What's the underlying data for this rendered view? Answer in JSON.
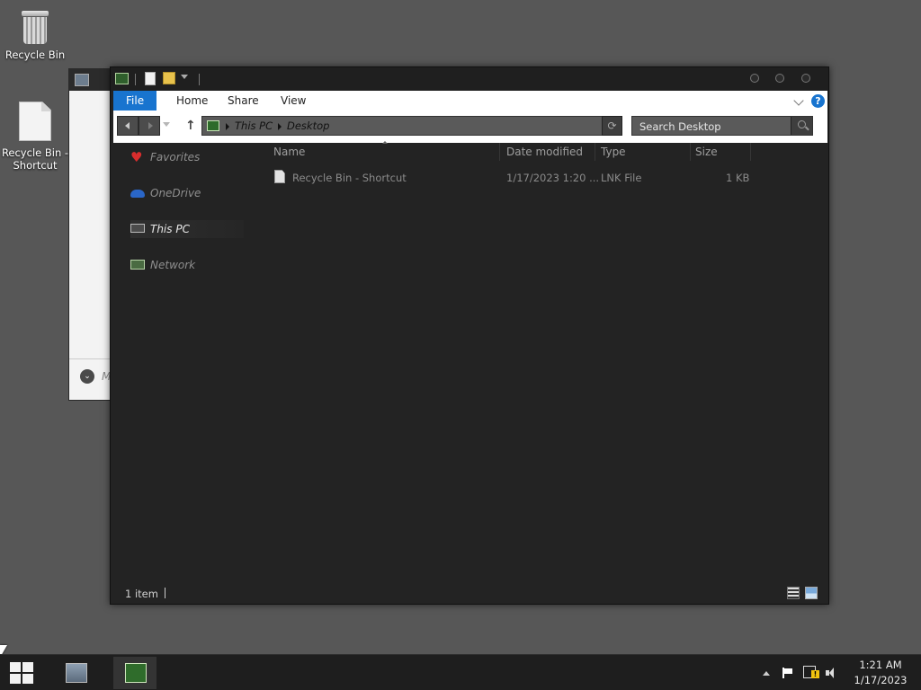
{
  "desktop": {
    "icons": [
      {
        "label": "Recycle Bin"
      },
      {
        "label": "Recycle Bin - Shortcut"
      }
    ]
  },
  "background_window": {
    "footer_text": "M"
  },
  "explorer": {
    "quick_access": [
      "explorer-icon",
      "properties-icon",
      "new-folder-icon",
      "customize-dropdown"
    ],
    "ribbon_tabs": [
      "File",
      "Home",
      "Share",
      "View"
    ],
    "help_label": "?",
    "address": {
      "crumbs": [
        "This PC",
        "Desktop"
      ]
    },
    "refresh_label": "⟳",
    "search": {
      "placeholder": "Search Desktop"
    },
    "nav_pane": [
      {
        "label": "Favorites",
        "icon": "heart-icon"
      },
      {
        "label": "OneDrive",
        "icon": "cloud-icon"
      },
      {
        "label": "This PC",
        "icon": "monitor-icon",
        "selected": true
      },
      {
        "label": "Network",
        "icon": "network-icon"
      }
    ],
    "columns": [
      "Name",
      "Date modified",
      "Type",
      "Size"
    ],
    "rows": [
      {
        "name": "Recycle Bin - Shortcut",
        "date": "1/17/2023 1:20 ...",
        "type": "LNK File",
        "size": "1 KB"
      }
    ],
    "status": "1 item"
  },
  "taskbar": {
    "apps": [
      "resource-monitor-icon",
      "explorer-icon"
    ],
    "time": "1:21 AM",
    "date": "1/17/2023"
  }
}
